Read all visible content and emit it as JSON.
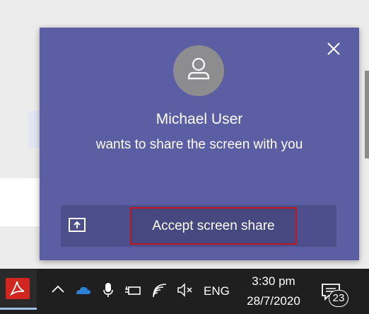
{
  "notification": {
    "caller_name": "Michael User",
    "message": "wants to share the screen with you",
    "accept_label": "Accept screen share",
    "close_icon": "close-icon",
    "share_icon": "share-screen-icon",
    "avatar_icon": "person-avatar-icon"
  },
  "taskbar": {
    "tray_icons": [
      "chevron-up-icon",
      "onedrive-cloud-icon",
      "microphone-icon",
      "battery-charging-icon",
      "wifi-icon",
      "speaker-muted-icon"
    ],
    "language": "ENG",
    "time": "3:30 pm",
    "date": "28/7/2020",
    "notification_count": "23"
  },
  "colors": {
    "toast_bg": "#5b5ea3",
    "action_bar_bg": "#4d4f8d",
    "highlight_border": "#c0141e",
    "taskbar_bg": "#1f1f1f"
  }
}
